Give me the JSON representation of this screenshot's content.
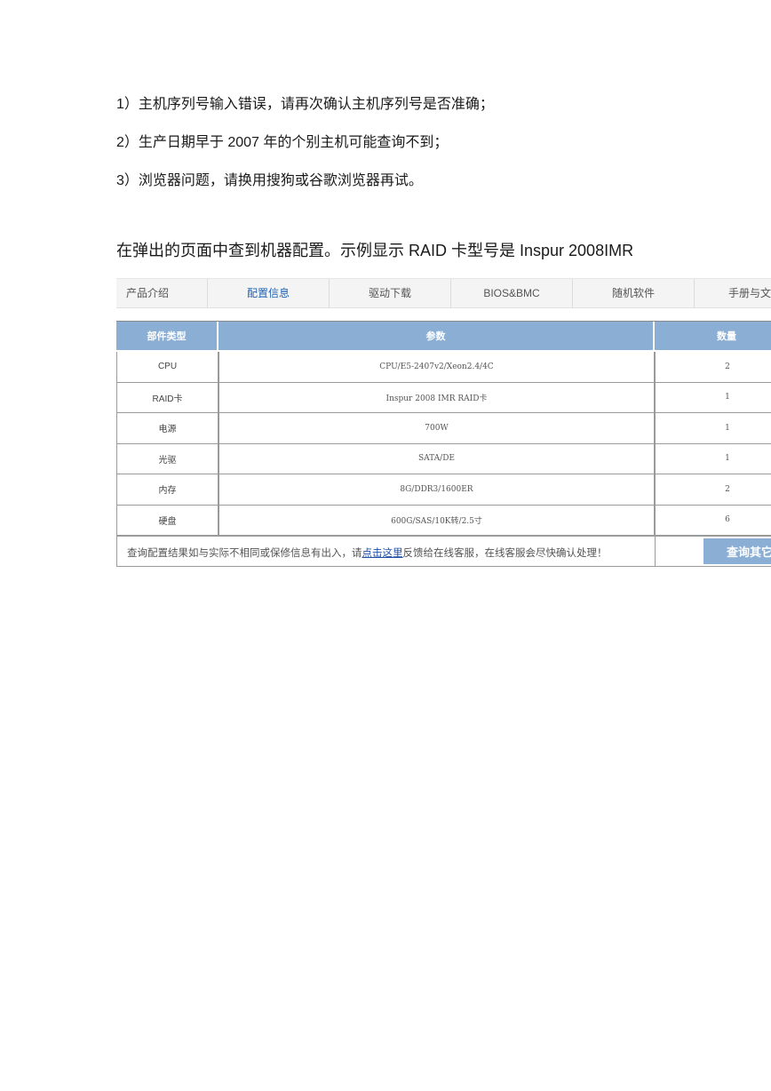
{
  "notes": [
    "1）主机序列号输入错误，请再次确认主机序列号是否准确；",
    "2）生产日期早于 2007 年的个别主机可能查询不到；",
    "3）浏览器问题，请换用搜狗或谷歌浏览器再试。"
  ],
  "heading": "在弹出的页面中查到机器配置。示例显示 RAID 卡型号是 Inspur 2008IMR",
  "tabs": [
    "产品介绍",
    "配置信息",
    "驱动下载",
    "BIOS&BMC",
    "随机软件",
    "手册与文"
  ],
  "active_tab": "配置信息",
  "table": {
    "headers": [
      "部件类型",
      "参数",
      "数量"
    ],
    "rows": [
      {
        "type": "CPU",
        "param": "CPU/E5-2407v2/Xeon2.4/4C",
        "qty": "2"
      },
      {
        "type": "RAID卡",
        "param": "Inspur 2008 IMR RAID卡",
        "qty": "1"
      },
      {
        "type": "电源",
        "param": "700W",
        "qty": "1"
      },
      {
        "type": "光驱",
        "param": "SATA/DE",
        "qty": "1"
      },
      {
        "type": "内存",
        "param": "8G/DDR3/1600ER",
        "qty": "2"
      },
      {
        "type": "硬盘",
        "param": "600G/SAS/10K转/2.5寸",
        "qty": "6"
      }
    ]
  },
  "footer": {
    "text_before": "查询配置结果如与实际不相同或保修信息有出入，请",
    "link": "点击这里",
    "text_after": "反馈给在线客服，在线客服会尽快确认处理！",
    "button": "查询其它"
  },
  "colors": {
    "header_bg": "#8aaed4",
    "active_tab": "#1f63b5",
    "link": "#1f4fa8"
  }
}
